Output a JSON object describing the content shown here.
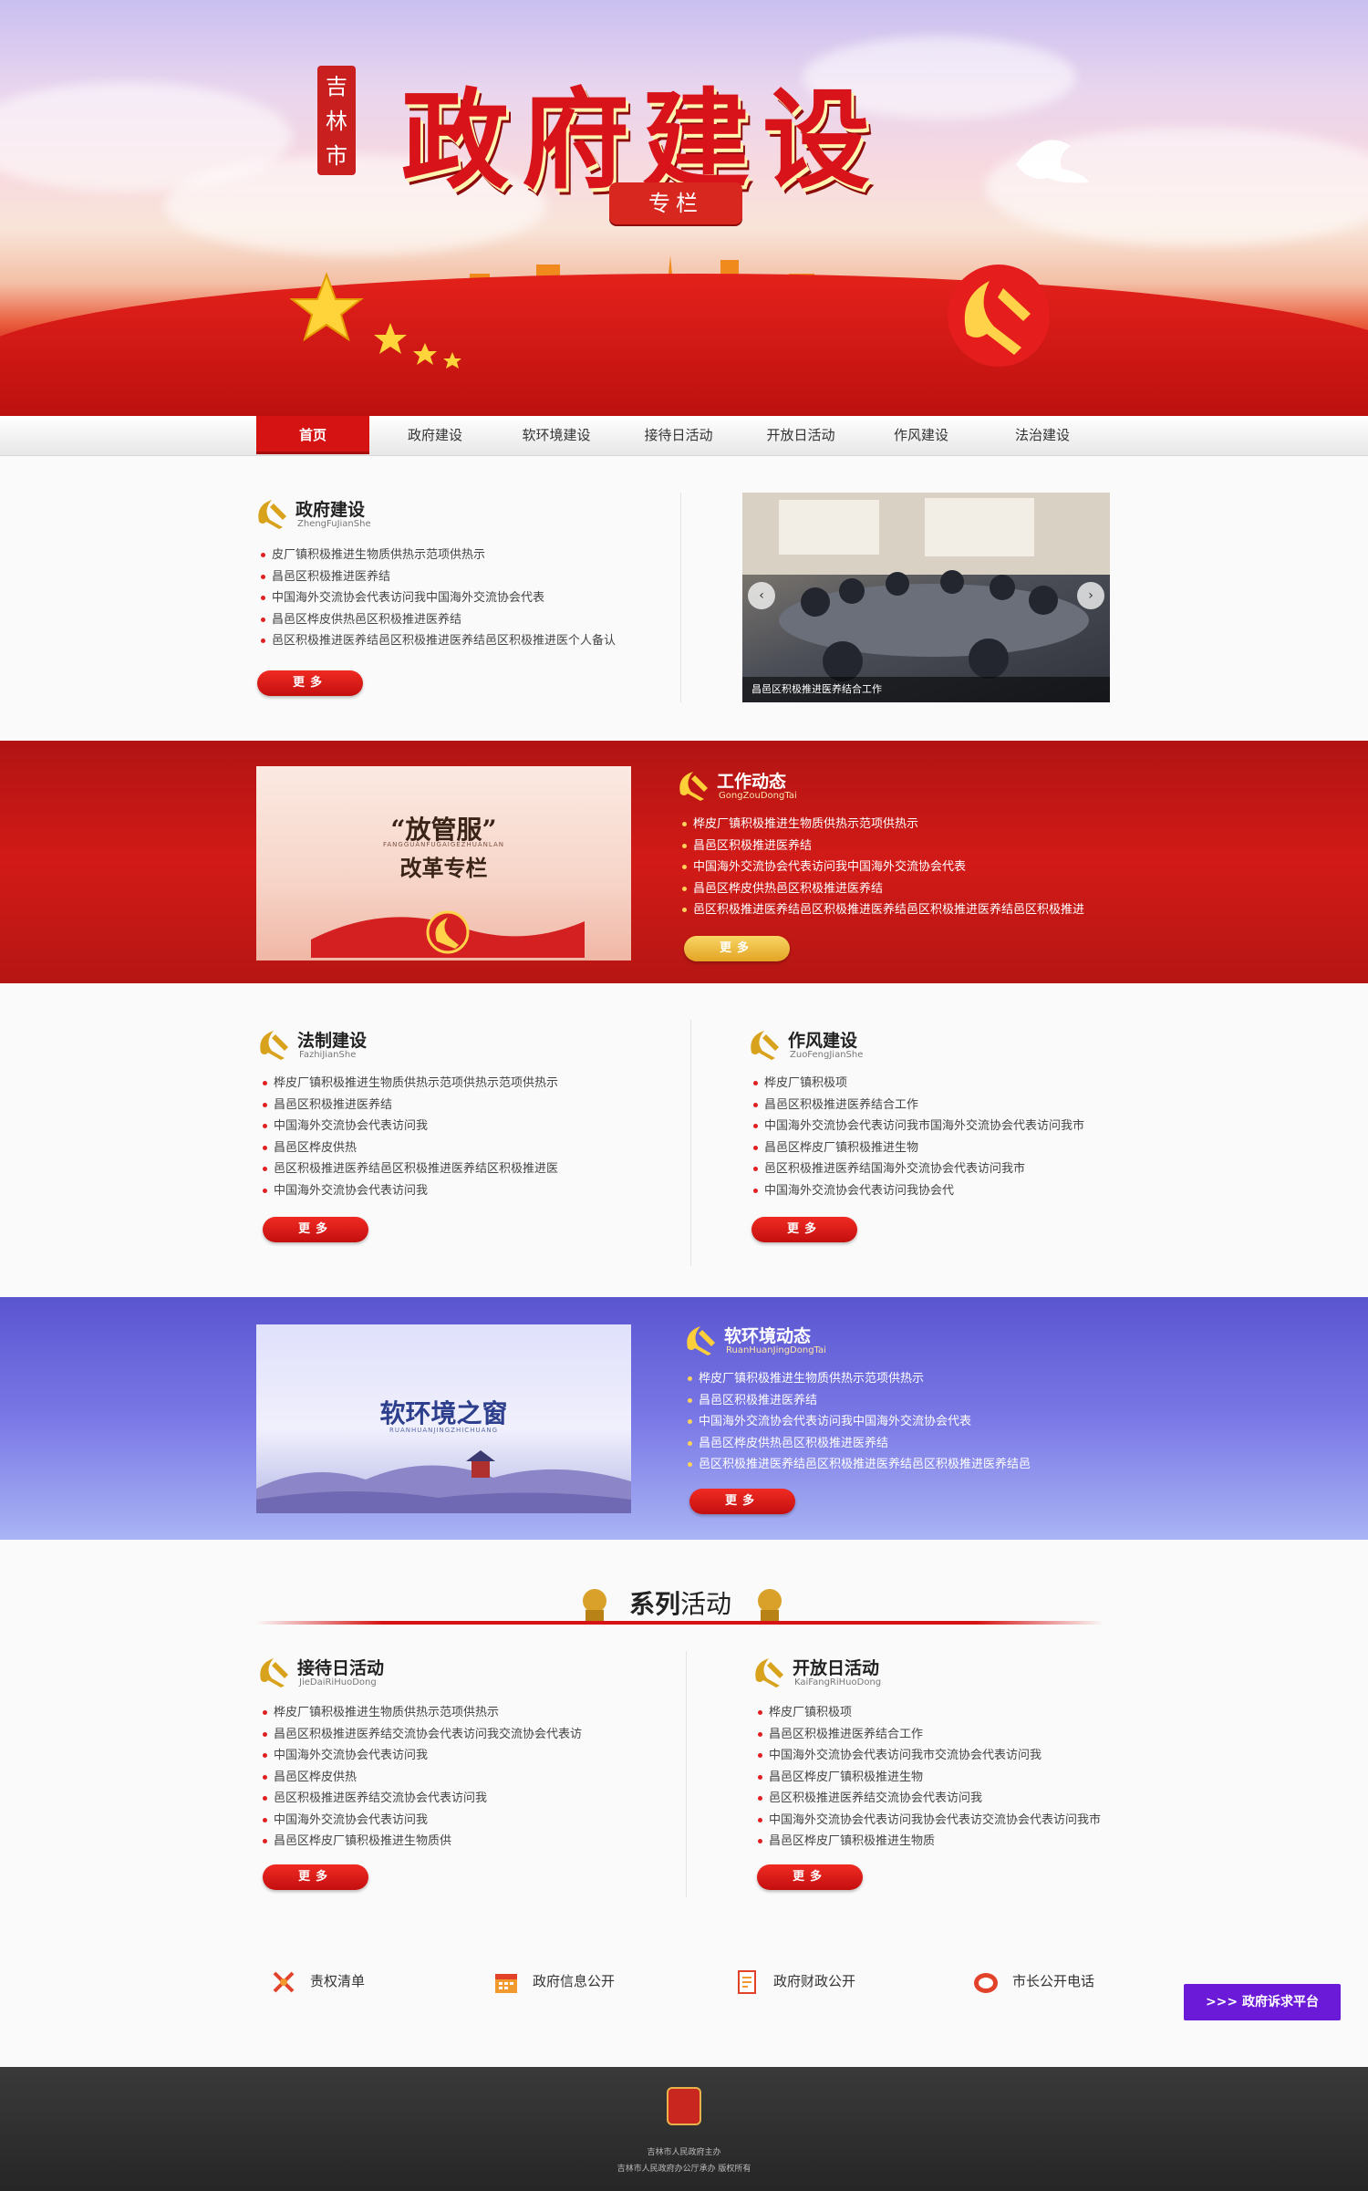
{
  "banner": {
    "title": "政府建设",
    "tag": "专栏",
    "seal": [
      "吉",
      "林",
      "市"
    ]
  },
  "nav": {
    "items": [
      "首页",
      "政府建设",
      "软环境建设",
      "接待日活动",
      "开放日活动",
      "作风建设",
      "法治建设"
    ],
    "active": 0
  },
  "gov": {
    "title": "政府建设",
    "pinyin": "ZhengFuJianShe",
    "items": [
      "皮厂镇积极推进生物质供热示范项供热示",
      "昌邑区积极推进医养结",
      "中国海外交流协会代表访问我中国海外交流协会代表",
      "昌邑区桦皮供热邑区积极推进医养结",
      "邑区积极推进医养结邑区积极推进医养结邑区积极推进医个人备认"
    ],
    "more": "更多",
    "slider_caption": "昌邑区积极推进医养结合工作",
    "prev": "‹",
    "next": "›"
  },
  "work": {
    "title": "工作动态",
    "pinyin": "GongZouDongTai",
    "items": [
      "桦皮厂镇积极推进生物质供热示范项供热示",
      "昌邑区积极推进医养结",
      "中国海外交流协会代表访问我中国海外交流协会代表",
      "昌邑区桦皮供热邑区积极推进医养结",
      "邑区积极推进医养结邑区积极推进医养结邑区积极推进医养结邑区积极推进"
    ],
    "more": "更多",
    "feature_title_1": "“放管服”",
    "feature_pinyin": "FANGGUANFUGAIGEZHUANLAN",
    "feature_title_2": "改革专栏"
  },
  "law": {
    "title": "法制建设",
    "pinyin": "FazhiJianShe",
    "items": [
      "桦皮厂镇积极推进生物质供热示范项供热示范项供热示",
      "昌邑区积极推进医养结",
      "中国海外交流协会代表访问我",
      "昌邑区桦皮供热",
      "邑区积极推进医养结邑区积极推进医养结区积极推进医",
      "中国海外交流协会代表访问我"
    ],
    "more": "更多"
  },
  "style": {
    "title": "作风建设",
    "pinyin": "ZuoFengJianShe",
    "items": [
      "桦皮厂镇积极项",
      "昌邑区积极推进医养结合工作",
      "中国海外交流协会代表访问我市国海外交流协会代表访问我市",
      "昌邑区桦皮厂镇积极推进生物",
      "邑区积极推进医养结国海外交流协会代表访问我市",
      "中国海外交流协会代表访问我协会代"
    ],
    "more": "更多"
  },
  "soft": {
    "title": "软环境动态",
    "pinyin": "RuanHuanJingDongTai",
    "items": [
      "桦皮厂镇积极推进生物质供热示范项供热示",
      "昌邑区积极推进医养结",
      "中国海外交流协会代表访问我中国海外交流协会代表",
      "昌邑区桦皮供热邑区积极推进医养结",
      "邑区积极推进医养结邑区积极推进医养结邑区积极推进医养结邑"
    ],
    "more": "更多",
    "feature_title": "软环境之窗",
    "feature_pinyin": "RUANHUANJINGZHICHUANG"
  },
  "series": {
    "bold": "系列",
    "rest": "活动"
  },
  "reception": {
    "title": "接待日活动",
    "pinyin": "JieDaiRiHuoDong",
    "items": [
      "桦皮厂镇积极推进生物质供热示范项供热示",
      "昌邑区积极推进医养结交流协会代表访问我交流协会代表访",
      "中国海外交流协会代表访问我",
      "昌邑区桦皮供热",
      "邑区积极推进医养结交流协会代表访问我",
      "中国海外交流协会代表访问我",
      "昌邑区桦皮厂镇积极推进生物质供"
    ],
    "more": "更多"
  },
  "open": {
    "title": "开放日活动",
    "pinyin": "KaiFangRiHuoDong",
    "items": [
      "桦皮厂镇积极项",
      "昌邑区积极推进医养结合工作",
      "中国海外交流协会代表访问我市交流协会代表访问我",
      "昌邑区桦皮厂镇积极推进生物",
      "邑区积极推进医养结交流协会代表访问我",
      "中国海外交流协会代表访问我协会代表访交流协会代表访问我市",
      "昌邑区桦皮厂镇积极推进生物质"
    ],
    "more": "更多"
  },
  "links": [
    {
      "label": "责权清单",
      "icon": "list-icon"
    },
    {
      "label": "政府信息公开",
      "icon": "calendar-icon"
    },
    {
      "label": "政府财政公开",
      "icon": "finance-icon"
    },
    {
      "label": "市长公开电话",
      "icon": "phone-icon"
    }
  ],
  "petition": ">>> 政府诉求平台",
  "footer": {
    "line1": "吉林市人民政府主办",
    "line2": "吉林市人民政府办公厅承办 版权所有"
  },
  "colors": {
    "primary_red": "#d61313",
    "gold": "#e8b24a",
    "purple": "#6b1ad8"
  }
}
